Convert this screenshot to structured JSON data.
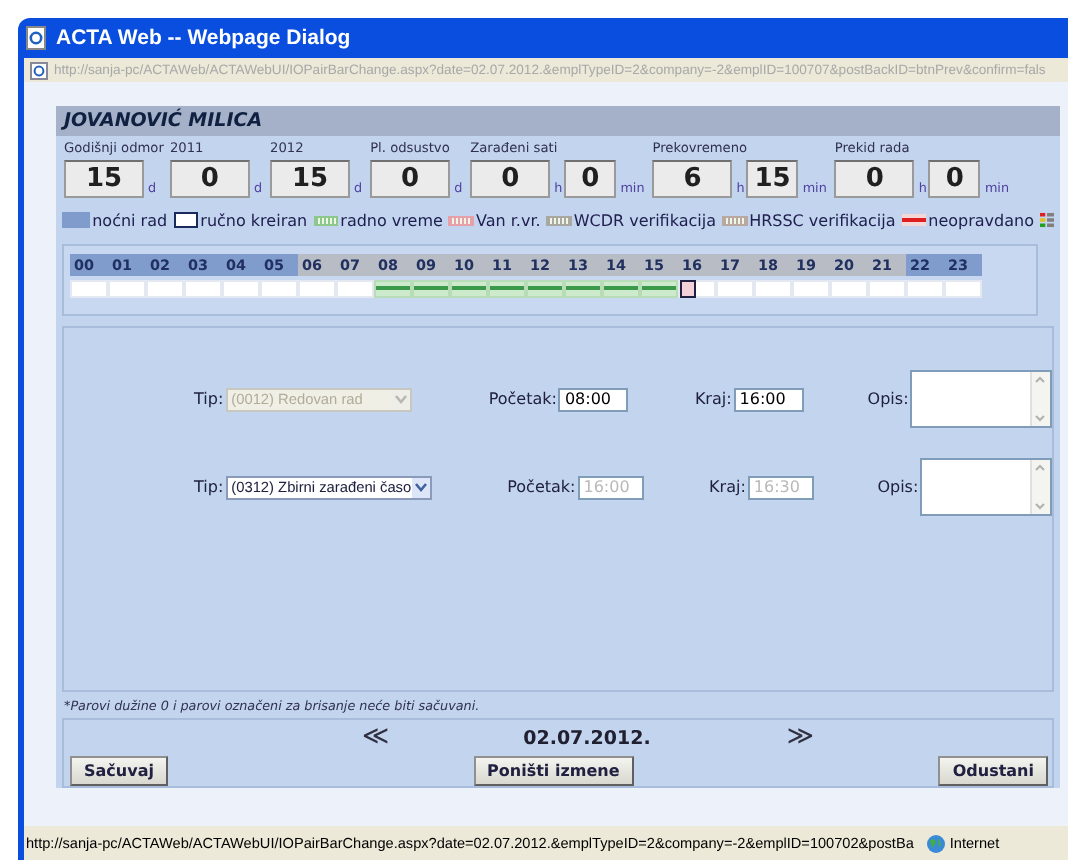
{
  "window": {
    "title": "ACTA Web -- Webpage Dialog",
    "address": "http://sanja-pc/ACTAWeb/ACTAWebUI/IOPairBarChange.aspx?date=02.07.2012.&emplTypeID=2&company=-2&emplID=100707&postBackID=btnPrev&confirm=fals"
  },
  "employee": "JOVANOVIĆ MILICA",
  "stats": [
    {
      "label": "Godišnji odmor",
      "values": [
        {
          "value": "15",
          "unit": "d"
        }
      ]
    },
    {
      "label": "2011",
      "values": [
        {
          "value": "0",
          "unit": "d"
        }
      ]
    },
    {
      "label": "2012",
      "values": [
        {
          "value": "15",
          "unit": "d"
        }
      ]
    },
    {
      "label": "Pl. odsustvo",
      "values": [
        {
          "value": "0",
          "unit": "d"
        }
      ]
    },
    {
      "label": "Zarađeni sati",
      "values": [
        {
          "value": "0",
          "unit": "h"
        },
        {
          "value": "0",
          "unit": "min"
        }
      ]
    },
    {
      "label": "Prekovremeno",
      "values": [
        {
          "value": "6",
          "unit": "h"
        },
        {
          "value": "15",
          "unit": "min"
        }
      ]
    },
    {
      "label": "Prekid rada",
      "values": [
        {
          "value": "0",
          "unit": "h"
        },
        {
          "value": "0",
          "unit": "min"
        }
      ]
    }
  ],
  "legend": [
    {
      "label": "noćni rad",
      "kind": "fill",
      "color": "#7f9ccc"
    },
    {
      "label": "ručno kreiran",
      "kind": "outline",
      "color": "#1a2a5a"
    },
    {
      "label": "radno vreme",
      "kind": "hatch",
      "color": "#8cc88c"
    },
    {
      "label": "Van r.vr.",
      "kind": "hatch",
      "color": "#e8a0a8"
    },
    {
      "label": "WCDR verifikacija",
      "kind": "hatch",
      "color": "#a8a8a0"
    },
    {
      "label": "HRSSC verifikacija",
      "kind": "hatch",
      "color": "#b8a8a0"
    },
    {
      "label": "neopravdano",
      "kind": "line",
      "color": "#e02020"
    }
  ],
  "hours": [
    {
      "label": "00",
      "night": true,
      "work": false,
      "manual": false
    },
    {
      "label": "01",
      "night": true,
      "work": false,
      "manual": false
    },
    {
      "label": "02",
      "night": true,
      "work": false,
      "manual": false
    },
    {
      "label": "03",
      "night": true,
      "work": false,
      "manual": false
    },
    {
      "label": "04",
      "night": true,
      "work": false,
      "manual": false
    },
    {
      "label": "05",
      "night": true,
      "work": false,
      "manual": false
    },
    {
      "label": "06",
      "night": false,
      "work": false,
      "manual": false
    },
    {
      "label": "07",
      "night": false,
      "work": false,
      "manual": false
    },
    {
      "label": "08",
      "night": false,
      "work": true,
      "manual": false
    },
    {
      "label": "09",
      "night": false,
      "work": true,
      "manual": false
    },
    {
      "label": "10",
      "night": false,
      "work": true,
      "manual": false
    },
    {
      "label": "11",
      "night": false,
      "work": true,
      "manual": false
    },
    {
      "label": "12",
      "night": false,
      "work": true,
      "manual": false
    },
    {
      "label": "13",
      "night": false,
      "work": true,
      "manual": false
    },
    {
      "label": "14",
      "night": false,
      "work": true,
      "manual": false
    },
    {
      "label": "15",
      "night": false,
      "work": true,
      "manual": false
    },
    {
      "label": "16",
      "night": false,
      "work": false,
      "manual": true
    },
    {
      "label": "17",
      "night": false,
      "work": false,
      "manual": false
    },
    {
      "label": "18",
      "night": false,
      "work": false,
      "manual": false
    },
    {
      "label": "19",
      "night": false,
      "work": false,
      "manual": false
    },
    {
      "label": "20",
      "night": false,
      "work": false,
      "manual": false
    },
    {
      "label": "21",
      "night": false,
      "work": false,
      "manual": false
    },
    {
      "label": "22",
      "night": true,
      "work": false,
      "manual": false
    },
    {
      "label": "23",
      "night": true,
      "work": false,
      "manual": false
    }
  ],
  "pairs": [
    {
      "type_label": "Tip:",
      "type": "(0012) Redovan rad",
      "type_disabled": true,
      "start_label": "Početak:",
      "start": "08:00",
      "start_disabled": false,
      "end_label": "Kraj:",
      "end": "16:00",
      "end_disabled": false,
      "desc_label": "Opis:"
    },
    {
      "type_label": "Tip:",
      "type": "(0312) Zbirni zarađeni časo",
      "type_disabled": false,
      "start_label": "Početak:",
      "start": "16:00",
      "start_disabled": true,
      "end_label": "Kraj:",
      "end": "16:30",
      "end_disabled": true,
      "desc_label": "Opis:"
    }
  ],
  "note": "*Parovi dužine 0 i parovi označeni za brisanje neće biti sačuvani.",
  "nav": {
    "prev": "≪",
    "date": "02.07.2012.",
    "next": "≫"
  },
  "buttons": {
    "save": "Sačuvaj",
    "reset": "Poništi izmene",
    "cancel": "Odustani"
  },
  "status_bar": {
    "url": "http://sanja-pc/ACTAWeb/ACTAWebUI/IOPairBarChange.aspx?date=02.07.2012.&emplTypeID=2&company=-2&emplID=100702&postBa",
    "zone": "Internet"
  }
}
